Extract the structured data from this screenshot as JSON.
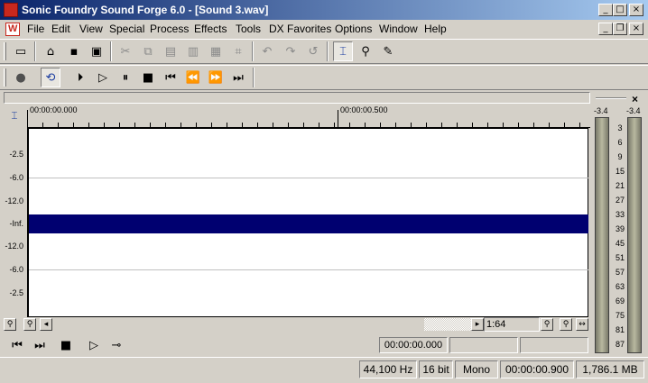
{
  "window": {
    "title": "Sonic Foundry Sound Forge 6.0 - [Sound 3.wav]",
    "caption_buttons": [
      "_",
      "□",
      "×"
    ],
    "mdi_buttons": [
      "_",
      "❐",
      "×"
    ]
  },
  "menu": {
    "items": [
      "File",
      "Edit",
      "View",
      "Special",
      "Process",
      "Effects",
      "Tools",
      "DX Favorites",
      "Options",
      "Window",
      "Help"
    ]
  },
  "toolbar1": {
    "buttons": [
      {
        "icon": "new-file-icon",
        "glyph": "▭"
      },
      {
        "icon": "open-folder-icon",
        "glyph": "⌂"
      },
      {
        "icon": "save-icon",
        "glyph": "▪"
      },
      {
        "icon": "save-as-icon",
        "glyph": "▣"
      },
      {
        "icon": "cut-icon",
        "glyph": "✂"
      },
      {
        "icon": "copy-icon",
        "glyph": "⧉"
      },
      {
        "icon": "paste-icon",
        "glyph": "▤"
      },
      {
        "icon": "paste-special-icon",
        "glyph": "▥"
      },
      {
        "icon": "mix-icon",
        "glyph": "▦"
      },
      {
        "icon": "crop-icon",
        "glyph": "⌗"
      },
      {
        "icon": "undo-icon",
        "glyph": "↶"
      },
      {
        "icon": "redo-icon",
        "glyph": "↷"
      },
      {
        "icon": "repeat-icon",
        "glyph": "↺"
      },
      {
        "icon": "edit-tool-icon",
        "glyph": "⌶"
      },
      {
        "icon": "magnify-tool-icon",
        "glyph": "⚲"
      },
      {
        "icon": "pencil-tool-icon",
        "glyph": "✎"
      }
    ]
  },
  "toolbar2": {
    "buttons": [
      {
        "icon": "record-icon",
        "glyph": "●"
      },
      {
        "icon": "loop-playback-icon",
        "glyph": "⟲"
      },
      {
        "icon": "play-all-icon",
        "glyph": "⏵"
      },
      {
        "icon": "play-icon",
        "glyph": "▷"
      },
      {
        "icon": "pause-icon",
        "glyph": "⏸"
      },
      {
        "icon": "stop-icon",
        "glyph": "■"
      },
      {
        "icon": "go-to-start-icon",
        "glyph": "⏮"
      },
      {
        "icon": "rewind-icon",
        "glyph": "⏪"
      },
      {
        "icon": "forward-icon",
        "glyph": "⏩"
      },
      {
        "icon": "go-to-end-icon",
        "glyph": "⏭"
      }
    ]
  },
  "timeline": {
    "marker_start": "00:00:00.000",
    "marker_mid": "00:00:00.500"
  },
  "db_scale": [
    "-2.5",
    "-6.0",
    "-12.0",
    "-Inf.",
    "-12.0",
    "-6.0",
    "-2.5"
  ],
  "zoom": {
    "ratio": "1:64"
  },
  "transport": {
    "position": "00:00:00.000",
    "selection_start": "",
    "selection_end": ""
  },
  "meters": {
    "peak_left": "-3.4",
    "peak_right": "-3.4",
    "scale": [
      "3",
      "6",
      "9",
      "15",
      "21",
      "27",
      "33",
      "39",
      "45",
      "51",
      "57",
      "63",
      "69",
      "75",
      "81",
      "87"
    ]
  },
  "status": {
    "sample_rate": "44,100 Hz",
    "bit_depth": "16 bit",
    "channels": "Mono",
    "length": "00:00:00.900",
    "free_space": "1,786.1 MB"
  },
  "colors": {
    "title_gradient_start": "#0a246a",
    "waveform": "#000070",
    "panel": "#d4d0c8"
  }
}
